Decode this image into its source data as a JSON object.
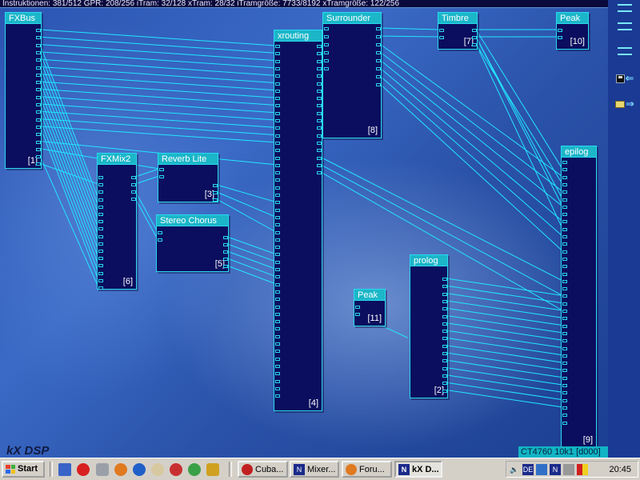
{
  "status_bar": {
    "text": "Instruktionen: 381/512 GPR: 208/256 iTram: 32/128 xTram: 28/32 iTramgröße: 7733/8192 xTramgröße: 122/256"
  },
  "workspace": {
    "watermark": "kX DSP"
  },
  "plugins": [
    {
      "id": "fxbus",
      "title": "FXBus",
      "number": "[1]"
    },
    {
      "id": "fxmix2",
      "title": "FXMix2",
      "number": "[6]"
    },
    {
      "id": "reverb",
      "title": "Reverb Lite",
      "number": "[3]"
    },
    {
      "id": "chorus",
      "title": "Stereo Chorus",
      "number": "[5]"
    },
    {
      "id": "xrouting",
      "title": "xrouting",
      "number": "[4]"
    },
    {
      "id": "surrounder",
      "title": "Surrounder",
      "number": "[8]"
    },
    {
      "id": "timbre",
      "title": "Timbre",
      "number": "[7]"
    },
    {
      "id": "peak1",
      "title": "Peak",
      "number": "[10]"
    },
    {
      "id": "peak2",
      "title": "Peak",
      "number": "[11]"
    },
    {
      "id": "prolog",
      "title": "prolog",
      "number": "[2]"
    },
    {
      "id": "epilog",
      "title": "epilog",
      "number": "[9]"
    }
  ],
  "card_label": "CT4760 10k1 [d000]",
  "colors": {
    "wire": "#22e6ff",
    "plugin_bg": "#0b0d5e",
    "title_bg": "#1bb6c8",
    "workspace": "#2c55b2"
  },
  "toolbar": [
    {
      "id": "view1",
      "icon": "bars-icon"
    },
    {
      "id": "view2",
      "icon": "bars-icon"
    },
    {
      "id": "view3",
      "icon": "bars-icon"
    },
    {
      "id": "save",
      "icon": "save-icon"
    },
    {
      "id": "load",
      "icon": "open-folder-icon"
    }
  ],
  "taskbar": {
    "start": "Start",
    "tasks": [
      {
        "label": "Cuba..."
      },
      {
        "label": "Mixer..."
      },
      {
        "label": "Foru..."
      },
      {
        "label": "kX D..."
      }
    ],
    "tray": {
      "lang": "DE",
      "clock": "20:45"
    }
  }
}
